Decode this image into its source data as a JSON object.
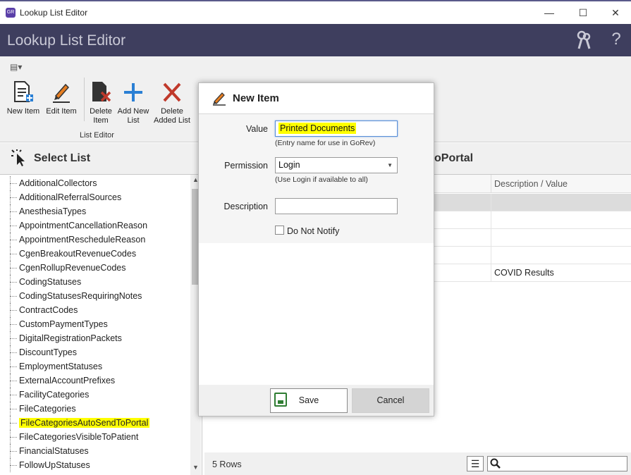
{
  "window": {
    "title": "Lookup List Editor",
    "app_icon": "GR",
    "minimize": "—",
    "maximize": "☐",
    "close": "✕"
  },
  "header": {
    "title": "Lookup List Editor",
    "icons": [
      "keys-icon",
      "help-icon"
    ]
  },
  "ribbon": {
    "group_label": "List Editor",
    "buttons": [
      {
        "label_l1": "New Item",
        "label_l2": ""
      },
      {
        "label_l1": "Edit Item",
        "label_l2": ""
      },
      {
        "label_l1": "Delete",
        "label_l2": "Item"
      },
      {
        "label_l1": "Add New",
        "label_l2": "List"
      },
      {
        "label_l1": "Delete",
        "label_l2": "Added List"
      }
    ]
  },
  "select_list": {
    "title": "Select List",
    "items": [
      "AdditionalCollectors",
      "AdditionalReferralSources",
      "AnesthesiaTypes",
      "AppointmentCancellationReason",
      "AppointmentRescheduleReason",
      "CgenBreakoutRevenueCodes",
      "CgenRollupRevenueCodes",
      "CodingStatuses",
      "CodingStatusesRequiringNotes",
      "ContractCodes",
      "CustomPaymentTypes",
      "DigitalRegistrationPackets",
      "DiscountTypes",
      "EmploymentStatuses",
      "ExternalAccountPrefixes",
      "FacilityCategories",
      "FileCategories",
      "FileCategoriesAutoSendToPortal",
      "FileCategoriesVisibleToPatient",
      "FinancialStatuses",
      "FollowUpStatuses"
    ],
    "selected_index": 17
  },
  "right_panel": {
    "title_fragment": "oPortal",
    "column_header": "Description / Value",
    "rows": [
      "",
      "",
      "",
      "",
      "COVID Results"
    ],
    "row_count": "5 Rows"
  },
  "dialog": {
    "title": "New Item",
    "value_label": "Value",
    "value": "Printed Documents",
    "value_hint": "(Entry name for use in GoRev)",
    "permission_label": "Permission",
    "permission": "Login",
    "permission_hint": "(Use Login if available to all)",
    "description_label": "Description",
    "description": "",
    "do_not_notify_label": "Do Not Notify",
    "save_label": "Save",
    "cancel_label": "Cancel"
  },
  "colors": {
    "header_bg": "#3e3e5e",
    "highlight": "#ffff00"
  }
}
